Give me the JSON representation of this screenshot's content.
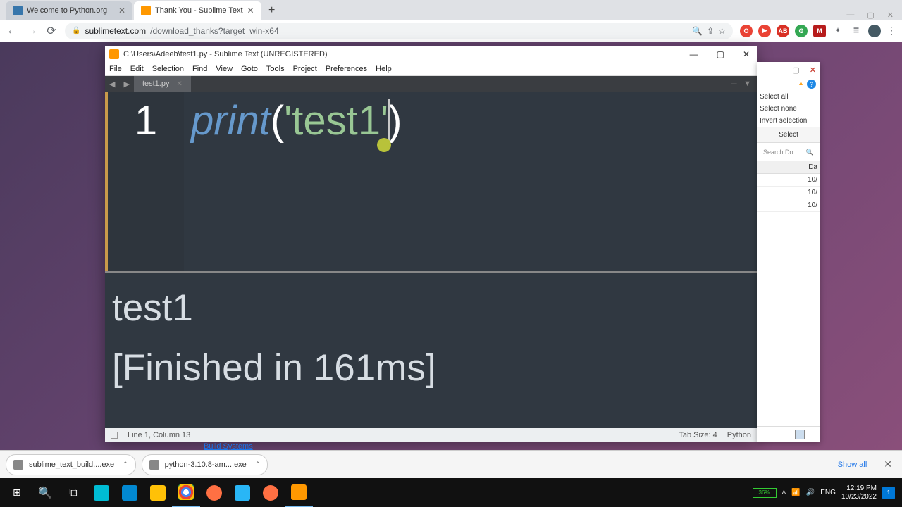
{
  "chrome": {
    "tabs": [
      {
        "title": "Welcome to Python.org",
        "favicon": "#3776ab"
      },
      {
        "title": "Thank You - Sublime Text",
        "favicon": "#ff9800"
      }
    ],
    "win_ctrl": {
      "min": "—",
      "max": "▢",
      "close": "✕"
    },
    "url_host": "sublimetext.com",
    "url_path": "/download_thanks?target=win-x64",
    "ext_colors": [
      "#ea4335",
      "#ea4335",
      "#d93025",
      "#34a853",
      "#b71c1c",
      "#5f6368",
      "#5f6368",
      "#5f6368"
    ],
    "avatar_color": "#455a64"
  },
  "sublime": {
    "title": "C:\\Users\\Adeeb\\test1.py - Sublime Text (UNREGISTERED)",
    "menu": [
      "File",
      "Edit",
      "Selection",
      "Find",
      "View",
      "Goto",
      "Tools",
      "Project",
      "Preferences",
      "Help"
    ],
    "tab": "test1.py",
    "line_no": "1",
    "code": {
      "fn": "print",
      "lp": "(",
      "q1": "'",
      "str": "test1",
      "q2": "'",
      "rp": ")"
    },
    "output_line1": "test1",
    "output_line2": "[Finished in 161ms]",
    "status": {
      "pos": "Line 1, Column 13",
      "tabsize": "Tab Size: 4",
      "lang": "Python"
    },
    "winbtn": {
      "min": "—",
      "max": "▢",
      "close": "✕"
    }
  },
  "sidepanel": {
    "items": [
      "Select all",
      "Select none",
      "Invert selection"
    ],
    "section": "Select",
    "search_ph": "Search Do...",
    "col": "Da",
    "rows": [
      "10/",
      "10/",
      "10/"
    ]
  },
  "link_remnant": "Build Systems",
  "downloads": {
    "items": [
      "sublime_text_build....exe",
      "python-3.10.8-am....exe"
    ],
    "showall": "Show all"
  },
  "taskbar": {
    "battery": "36%",
    "lang": "ENG",
    "time": "12:19 PM",
    "date": "10/23/2022",
    "notif": "1"
  }
}
